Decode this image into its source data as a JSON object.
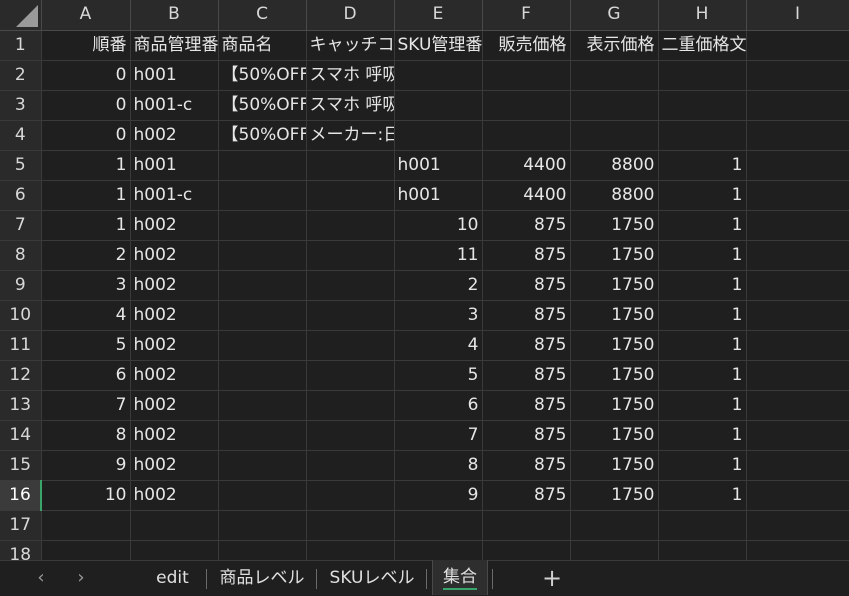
{
  "columns": [
    "A",
    "B",
    "C",
    "D",
    "E",
    "F",
    "G",
    "H",
    "I"
  ],
  "rows": [
    {
      "n": "1",
      "cells": [
        "順番",
        "商品管理番",
        "商品名",
        "キャッチコ",
        "SKU管理番",
        "販売価格",
        "表示価格",
        "二重価格文言管理番号",
        ""
      ]
    },
    {
      "n": "2",
      "cells": [
        "0",
        "h001",
        "【50%OFF",
        "スマホ 呼吸 オムツ　ギフト",
        "",
        "",
        "",
        "",
        ""
      ]
    },
    {
      "n": "3",
      "cells": [
        "0",
        "h001-c",
        "【50%OFF",
        "スマホ 呼吸 オムツ　ギフト",
        "",
        "",
        "",
        "",
        ""
      ]
    },
    {
      "n": "4",
      "cells": [
        "0",
        "h002",
        "【50%OFF",
        "メーカー:日本エイテックス eightex",
        "",
        "",
        "",
        "",
        ""
      ]
    },
    {
      "n": "5",
      "cells": [
        "1",
        "h001",
        "",
        "",
        "h001",
        "4400",
        "8800",
        "1",
        ""
      ]
    },
    {
      "n": "6",
      "cells": [
        "1",
        "h001-c",
        "",
        "",
        "h001",
        "4400",
        "8800",
        "1",
        ""
      ]
    },
    {
      "n": "7",
      "cells": [
        "1",
        "h002",
        "",
        "",
        "10",
        "875",
        "1750",
        "1",
        ""
      ]
    },
    {
      "n": "8",
      "cells": [
        "2",
        "h002",
        "",
        "",
        "11",
        "875",
        "1750",
        "1",
        ""
      ]
    },
    {
      "n": "9",
      "cells": [
        "3",
        "h002",
        "",
        "",
        "2",
        "875",
        "1750",
        "1",
        ""
      ]
    },
    {
      "n": "10",
      "cells": [
        "4",
        "h002",
        "",
        "",
        "3",
        "875",
        "1750",
        "1",
        ""
      ]
    },
    {
      "n": "11",
      "cells": [
        "5",
        "h002",
        "",
        "",
        "4",
        "875",
        "1750",
        "1",
        ""
      ]
    },
    {
      "n": "12",
      "cells": [
        "6",
        "h002",
        "",
        "",
        "5",
        "875",
        "1750",
        "1",
        ""
      ]
    },
    {
      "n": "13",
      "cells": [
        "7",
        "h002",
        "",
        "",
        "6",
        "875",
        "1750",
        "1",
        ""
      ]
    },
    {
      "n": "14",
      "cells": [
        "8",
        "h002",
        "",
        "",
        "7",
        "875",
        "1750",
        "1",
        ""
      ]
    },
    {
      "n": "15",
      "cells": [
        "9",
        "h002",
        "",
        "",
        "8",
        "875",
        "1750",
        "1",
        ""
      ]
    },
    {
      "n": "16",
      "cells": [
        "10",
        "h002",
        "",
        "",
        "9",
        "875",
        "1750",
        "1",
        ""
      ]
    },
    {
      "n": "17",
      "cells": [
        "",
        "",
        "",
        "",
        "",
        "",
        "",
        "",
        ""
      ]
    },
    {
      "n": "18",
      "cells": [
        "",
        "",
        "",
        "",
        "",
        "",
        "",
        "",
        ""
      ]
    }
  ],
  "selected_row": "16",
  "sheet_tabs": [
    "edit",
    "商品レベル",
    "SKUレベル",
    "集合"
  ],
  "active_tab": "集合",
  "nav": {
    "prev": "‹",
    "next": "›",
    "add": "+"
  },
  "colors": {
    "accent": "#3aa56b",
    "background": "#1f1f1f",
    "header": "#2a2a2a"
  }
}
